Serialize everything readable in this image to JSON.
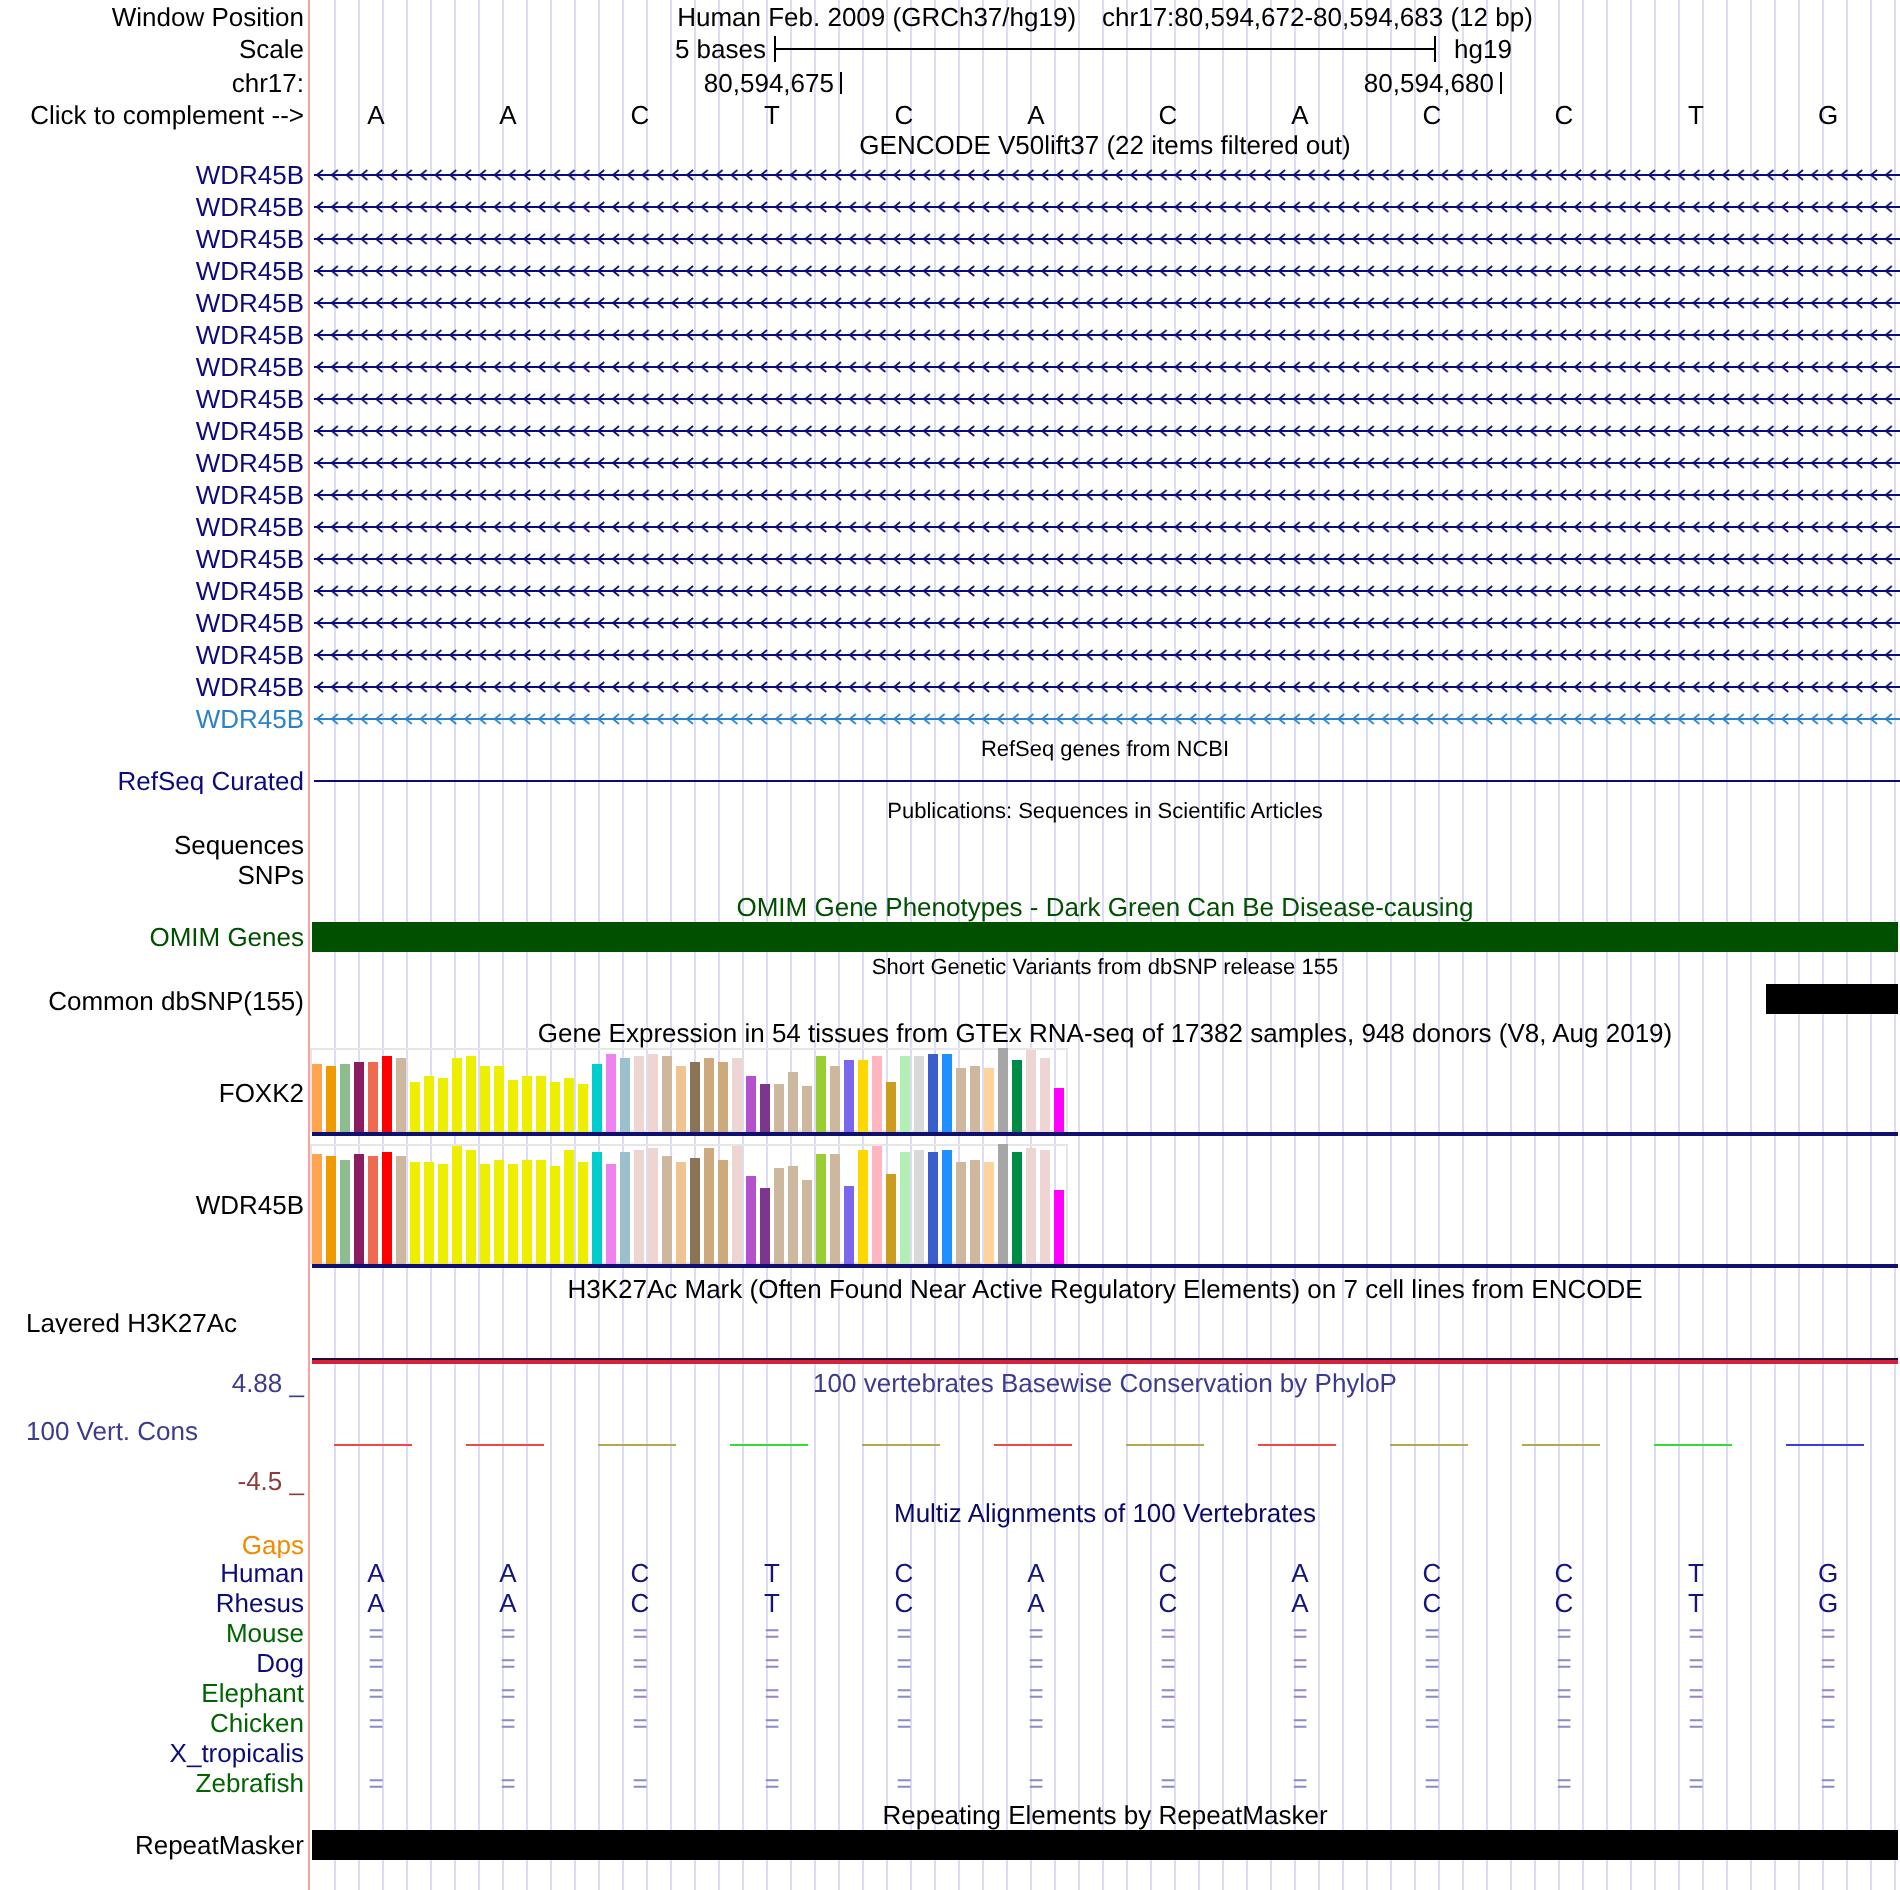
{
  "header": {
    "window_position": {
      "label": "Window Position",
      "assembly": "Human Feb. 2009 (GRCh37/hg19)",
      "range": "chr17:80,594,672-80,594,683 (12 bp)"
    },
    "scale": {
      "label": "Scale",
      "length": "5 bases",
      "assembly": "hg19"
    },
    "coordinates": {
      "label": "chr17:",
      "ticks": [
        "80,594,675",
        "80,594,680"
      ]
    },
    "bases": {
      "label": "Click to complement -->",
      "letters": [
        "A",
        "A",
        "C",
        "T",
        "C",
        "A",
        "C",
        "A",
        "C",
        "C",
        "T",
        "G"
      ]
    }
  },
  "tracks": [
    {
      "kind": "genes",
      "title": "GENCODE V50lift37 (22 items filtered out)",
      "items": [
        {
          "label": "WDR45B",
          "color": "#0c0c78"
        },
        {
          "label": "WDR45B",
          "color": "#0c0c78"
        },
        {
          "label": "WDR45B",
          "color": "#0c0c78"
        },
        {
          "label": "WDR45B",
          "color": "#0c0c78"
        },
        {
          "label": "WDR45B",
          "color": "#0c0c78"
        },
        {
          "label": "WDR45B",
          "color": "#0c0c78"
        },
        {
          "label": "WDR45B",
          "color": "#0c0c78"
        },
        {
          "label": "WDR45B",
          "color": "#0c0c78"
        },
        {
          "label": "WDR45B",
          "color": "#0c0c78"
        },
        {
          "label": "WDR45B",
          "color": "#0c0c78"
        },
        {
          "label": "WDR45B",
          "color": "#0c0c78"
        },
        {
          "label": "WDR45B",
          "color": "#0c0c78"
        },
        {
          "label": "WDR45B",
          "color": "#0c0c78"
        },
        {
          "label": "WDR45B",
          "color": "#0c0c78"
        },
        {
          "label": "WDR45B",
          "color": "#0c0c78"
        },
        {
          "label": "WDR45B",
          "color": "#0c0c78"
        },
        {
          "label": "WDR45B",
          "color": "#0c0c78"
        },
        {
          "label": "WDR45B",
          "color": "#2c82c8"
        }
      ]
    },
    {
      "kind": "line",
      "title": "RefSeq genes from NCBI",
      "label": "RefSeq Curated",
      "color": "#0c0c78"
    },
    {
      "kind": "empty",
      "title": "Publications: Sequences in Scientific Articles",
      "labels": [
        "Sequences",
        "SNPs"
      ]
    },
    {
      "kind": "bar",
      "title": "OMIM Gene Phenotypes - Dark Green Can Be Disease-causing",
      "label": "OMIM Genes",
      "color": "#005000"
    },
    {
      "kind": "variants",
      "title": "Short Genetic Variants from dbSNP release 155",
      "label": "Common dbSNP(155)"
    },
    {
      "kind": "expression",
      "title": "Gene Expression in 54 tissues from GTEx RNA-seq of 17382 samples, 948 donors (V8, Aug 2019)",
      "genes": [
        "FOXK2",
        "WDR45B"
      ]
    },
    {
      "kind": "signal",
      "title": "H3K27Ac Mark (Often Found Near Active Regulatory Elements) on 7 cell lines from ENCODE",
      "label": "Layered H3K27Ac"
    },
    {
      "kind": "conservation",
      "title": "100 vertebrates Basewise Conservation by PhyloP",
      "label": "100 Vert. Cons",
      "color": "#3c3c8c",
      "max": "4.88 _",
      "min": {
        "label": "-4.5 _",
        "color": "#8c3c3c"
      },
      "marks": [
        {
          "color": "#f04848"
        },
        {
          "color": "#f04848"
        },
        {
          "color": "#b0aa4c"
        },
        {
          "color": "#33dd33"
        },
        {
          "color": "#b0aa4c"
        },
        {
          "color": "#f04848"
        },
        {
          "color": "#b0aa4c"
        },
        {
          "color": "#f04848"
        },
        {
          "color": "#b0aa4c"
        },
        {
          "color": "#b0aa4c"
        },
        {
          "color": "#33dd33"
        },
        {
          "color": "#3c3cdc"
        }
      ]
    },
    {
      "kind": "alignment",
      "title": "Multiz Alignments of 100 Vertebrates",
      "color": "#0a0a64",
      "gaps": {
        "label": "Gaps",
        "color": "#f28a00"
      },
      "species": [
        {
          "label": "Human",
          "color": "#0c0c78",
          "kind": "bases",
          "bases": [
            "A",
            "A",
            "C",
            "T",
            "C",
            "A",
            "C",
            "A",
            "C",
            "C",
            "T",
            "G"
          ]
        },
        {
          "label": "Rhesus",
          "color": "#0c0c78",
          "kind": "bases",
          "bases": [
            "A",
            "A",
            "C",
            "T",
            "C",
            "A",
            "C",
            "A",
            "C",
            "C",
            "T",
            "G"
          ]
        },
        {
          "label": "Mouse",
          "color": "#006400",
          "kind": "matches",
          "bases": [
            "=",
            "=",
            "=",
            "=",
            "=",
            "=",
            "=",
            "=",
            "=",
            "=",
            "=",
            "="
          ]
        },
        {
          "label": "Dog",
          "color": "#0c0c78",
          "kind": "matches",
          "bases": [
            "=",
            "=",
            "=",
            "=",
            "=",
            "=",
            "=",
            "=",
            "=",
            "=",
            "=",
            "="
          ]
        },
        {
          "label": "Elephant",
          "color": "#006400",
          "kind": "matches",
          "bases": [
            "=",
            "=",
            "=",
            "=",
            "=",
            "=",
            "=",
            "=",
            "=",
            "=",
            "=",
            "="
          ]
        },
        {
          "label": "Chicken",
          "color": "#006400",
          "kind": "matches",
          "bases": [
            "=",
            "=",
            "=",
            "=",
            "=",
            "=",
            "=",
            "=",
            "=",
            "=",
            "=",
            "="
          ]
        },
        {
          "label": "X_tropicalis",
          "color": "#0c0c78"
        },
        {
          "label": "Zebrafish",
          "color": "#006400",
          "kind": "matches",
          "bases": [
            "=",
            "=",
            "=",
            "=",
            "=",
            "=",
            "=",
            "=",
            "=",
            "=",
            "=",
            "="
          ]
        }
      ]
    },
    {
      "kind": "bar",
      "title": "Repeating Elements by RepeatMasker",
      "label": "RepeatMasker",
      "color": "#000000"
    }
  ]
}
